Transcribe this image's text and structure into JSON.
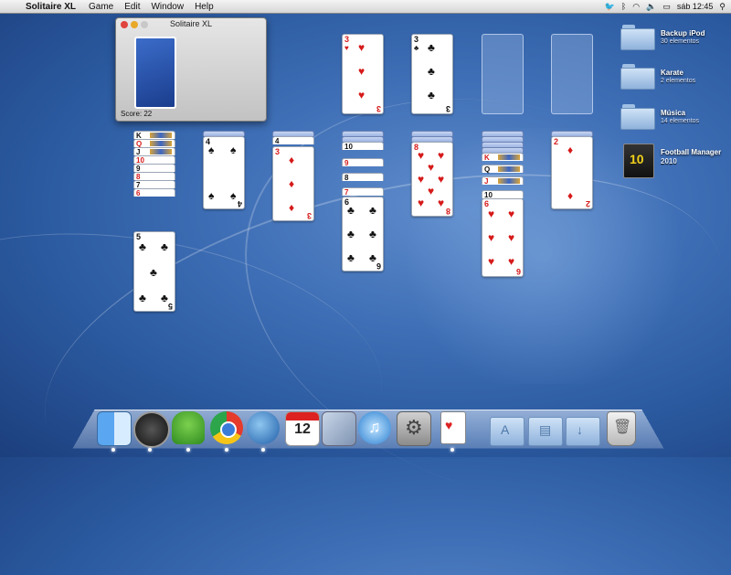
{
  "menubar": {
    "app_name": "Solitaire XL",
    "menus": [
      "Game",
      "Edit",
      "Window",
      "Help"
    ],
    "clock": "sáb 12:45"
  },
  "window": {
    "title": "Solitaire XL",
    "score": "Score: 22"
  },
  "foundation": [
    {
      "rank": "3",
      "suit": "♥",
      "color": "red"
    },
    {
      "rank": "3",
      "suit": "♣",
      "color": "black"
    }
  ],
  "tableau": {
    "col1_overlaps": [
      {
        "rank": "K",
        "color": "black"
      },
      {
        "rank": "Q",
        "color": "red"
      },
      {
        "rank": "J",
        "color": "black"
      },
      {
        "rank": "10",
        "color": "red"
      },
      {
        "rank": "9",
        "color": "black"
      },
      {
        "rank": "8",
        "color": "red"
      },
      {
        "rank": "7",
        "color": "black"
      },
      {
        "rank": "6",
        "color": "red"
      }
    ],
    "col1_top": {
      "rank": "5",
      "suit": "♣"
    },
    "col2_top": {
      "rank": "4",
      "suit": "♠"
    },
    "col3_overlaps": [
      {
        "rank": "4",
        "color": "black"
      }
    ],
    "col3_top": {
      "rank": "3",
      "suit": "♦"
    },
    "col4_overlaps": [
      {
        "rank": "10",
        "color": "black"
      },
      {
        "rank": "9",
        "color": "red"
      },
      {
        "rank": "8",
        "color": "black"
      },
      {
        "rank": "7",
        "color": "red"
      }
    ],
    "col4_top": {
      "rank": "6",
      "suit": "♣"
    },
    "col5_top": {
      "rank": "8",
      "suit": "♥"
    },
    "col6_overlaps": [
      {
        "rank": "K",
        "color": "red"
      },
      {
        "rank": "Q",
        "color": "black"
      },
      {
        "rank": "J",
        "color": "red"
      },
      {
        "rank": "10",
        "color": "black"
      }
    ],
    "col6_top": {
      "rank": "6",
      "suit": "♥"
    },
    "col7_top": {
      "rank": "2",
      "suit": "♦"
    }
  },
  "desktop": {
    "items": [
      {
        "name": "Backup iPod",
        "sub": "30 elementos"
      },
      {
        "name": "Karate",
        "sub": "2 elementos"
      },
      {
        "name": "Música",
        "sub": "14 elementos"
      },
      {
        "name": "Football Manager",
        "sub": "2010"
      }
    ],
    "fm_badge": "10"
  },
  "dock": {
    "ical_day": "12"
  }
}
